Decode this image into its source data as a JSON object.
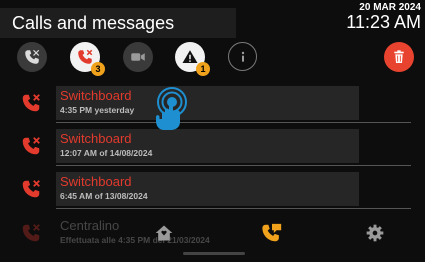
{
  "header": {
    "title": "Calls and messages",
    "date": "20 MAR 2024",
    "time": "11:23 AM"
  },
  "toolbar": {
    "missed_calls_badge": "3",
    "alerts_badge": "1"
  },
  "calls": [
    {
      "name": "Switchboard",
      "when": "4:35 PM yesterday"
    },
    {
      "name": "Switchboard",
      "when": "12:07 AM of 14/08/2024"
    },
    {
      "name": "Switchboard",
      "when": "6:45 AM of 13/08/2024"
    },
    {
      "name": "Centralino",
      "when": "Effettuata alle 4:35 PM del 21/03/2024"
    }
  ],
  "colors": {
    "missed": "#e23a2d",
    "badge": "#f0a21c",
    "delete": "#e8432f",
    "active_nav": "#f0a21c"
  },
  "icons": {
    "all_calls": "phone-all-icon",
    "missed_calls": "phone-missed-icon",
    "video": "video-camera-icon",
    "alert": "warning-icon",
    "info": "info-icon",
    "delete": "trash-icon",
    "home": "home-icon",
    "calls_nav": "phone-chat-icon",
    "settings": "gear-icon"
  }
}
